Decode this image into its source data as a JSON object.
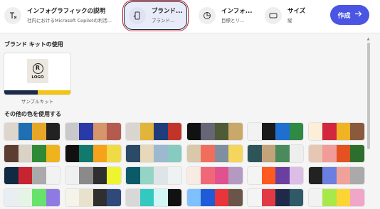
{
  "toolbar": {
    "steps": [
      {
        "title": "インフォグラフィックの説明",
        "subtitle": "社内におけるMicrosoft Copilotの利活...",
        "icon": "text-format-icon"
      },
      {
        "title": "ブランド...",
        "subtitle": "ブランド...",
        "icon": "phone-brush-icon"
      },
      {
        "title": "インフォ...",
        "subtitle": "目標とリ...",
        "icon": "chart-layout-icon"
      },
      {
        "title": "サイズ",
        "subtitle": "縦",
        "icon": "rectangle-icon"
      }
    ],
    "create_label": "作成",
    "accent": "#4a55e3"
  },
  "brand_kit": {
    "title": "ブランド キットの使用",
    "logo_letter": "R",
    "logo_text": "LOGO",
    "kit_label": "サンプルキット",
    "colors": [
      "#1b2a47",
      "#1b2a47",
      "#f2c413",
      "#f2c413"
    ]
  },
  "other_colors": {
    "title": "その他の色を使用する",
    "palettes": [
      [
        "#ddd6cc",
        "#1f6fb2",
        "#e6a728",
        "#222222"
      ],
      [
        "#c9c9c9",
        "#2a39a8",
        "#d6956a",
        "#b55a4e"
      ],
      [
        "#dad6cf",
        "#e2b43a",
        "#1f3d7a",
        "#c2332a"
      ],
      [
        "#111111",
        "#666677",
        "#4f5b36",
        "#c9a86a"
      ],
      [
        "#f2f2f2",
        "#1a1a1a",
        "#1f6fd0",
        "#2e8a45"
      ],
      [
        "#fdeed9",
        "#d2273d",
        "#f0b323",
        "#8a5a3c"
      ],
      [
        "#5b3d32",
        "#d8d3c5",
        "#2f8a35",
        "#efb31c"
      ],
      [
        "#111111",
        "#117a6d",
        "#f7a21b",
        "#f0da45"
      ],
      [
        "#2a4a66",
        "#e6d8b8",
        "#9db9cf",
        "#85cbbf"
      ],
      [
        "#d9c9aa",
        "#f06e5b",
        "#7f8fa1",
        "#f5d55c"
      ],
      [
        "#2c5459",
        "#c3a37a",
        "#4b8a5c",
        "#eeeeee"
      ],
      [
        "#e6c7b4",
        "#f29c9a",
        "#e35220",
        "#2e6e2c"
      ],
      [
        "#112a44",
        "#c8242f",
        "#aaaaaa",
        "#f2f2f2"
      ],
      [
        "#f0f0f0",
        "#8a8a8a",
        "#2f2f2f",
        "#eef52e"
      ],
      [
        "#0a5a6a",
        "#94d4c4",
        "#dde5e8",
        "#eef2f2"
      ],
      [
        "#f8ebe2",
        "#f06878",
        "#e2518f",
        "#b49ac2"
      ],
      [
        "#f4f4f4",
        "#ff5a1f",
        "#6b3fa0",
        "#dcbde6"
      ],
      [
        "#222222",
        "#6b7fe0",
        "#f0a29a",
        "#aaaaaa"
      ],
      [
        "#e9eef3",
        "#e5f5e5",
        "#67e26a",
        "#8f7ae2"
      ],
      [
        "#f6f3ea",
        "#e8e1cc",
        "#2f2f2f",
        "#2f4a7a"
      ],
      [
        "#d8d8d8",
        "#33c9c0",
        "#d2f5f5",
        "#111111"
      ],
      [
        "#7fc0ff",
        "#1f5bd6",
        "#e8343a",
        "#6a5548"
      ],
      [
        "#f4f4f4",
        "#e23a44",
        "#1f2a4a",
        "#2f5b68"
      ],
      [
        "#f2f2f2",
        "#a8e94a",
        "#fcd535",
        "#f0a6c8"
      ]
    ]
  },
  "scrollbar": {
    "label": "▲"
  }
}
